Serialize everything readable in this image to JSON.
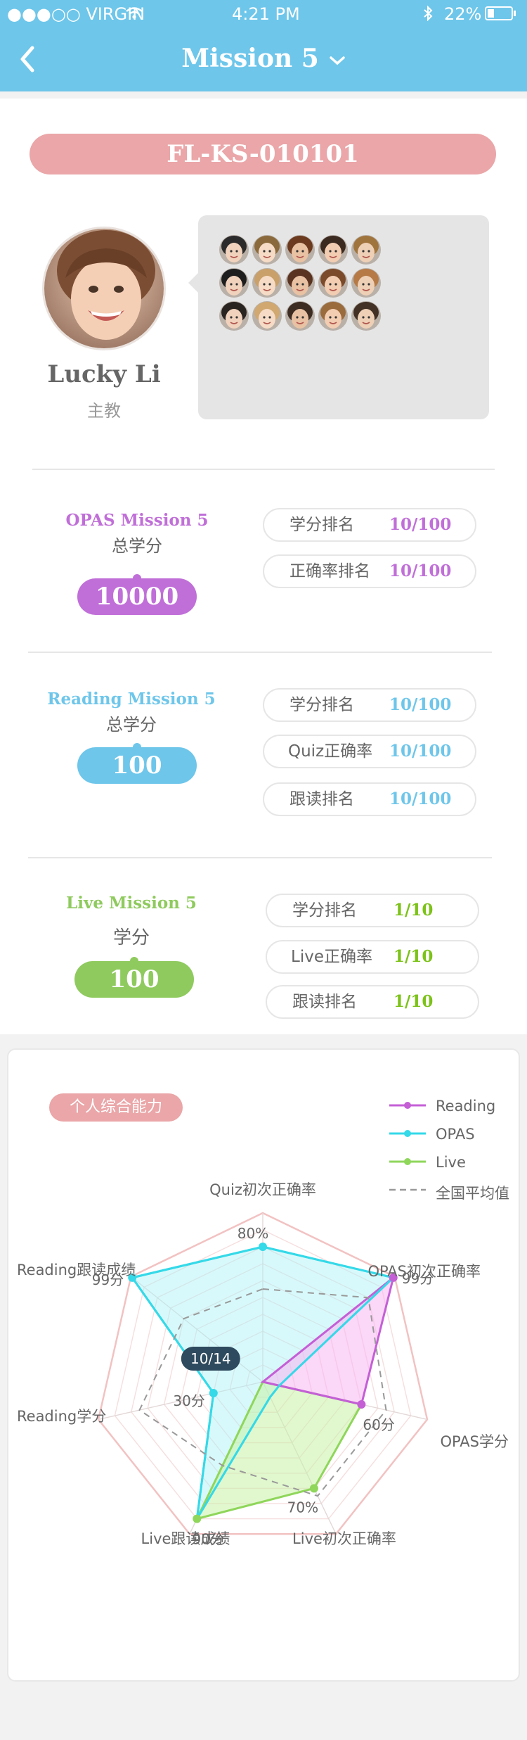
{
  "status_bar": {
    "carrier": "●●●○○ VIRGIN",
    "time": "4:21 PM",
    "battery": "22%"
  },
  "nav": {
    "title": "Mission 5"
  },
  "mission_code": "FL-KS-010101",
  "teacher": {
    "name": "Lucky Li",
    "role": "主教"
  },
  "student_count": 15,
  "opas": {
    "title": "OPAS Mission 5",
    "subtitle": "总学分",
    "score": "10000",
    "color": "#c06fd8",
    "ranks": [
      {
        "label": "学分排名",
        "value": "10/100"
      },
      {
        "label": "正确率排名",
        "value": "10/100"
      }
    ]
  },
  "reading": {
    "title": "Reading Mission 5",
    "subtitle": "总学分",
    "score": "100",
    "color": "#6ec6ea",
    "ranks": [
      {
        "label": "学分排名",
        "value": "10/100"
      },
      {
        "label": "Quiz正确率",
        "value": "10/100"
      },
      {
        "label": "跟读排名",
        "value": "10/100"
      }
    ]
  },
  "live": {
    "title": "Live Mission 5",
    "subtitle": "学分",
    "score": "100",
    "color": "#8fca5e",
    "value_color": "#7cc218",
    "ranks": [
      {
        "label": "学分排名",
        "value": "1/10"
      },
      {
        "label": "Live正确率",
        "value": "1/10"
      },
      {
        "label": "跟读排名",
        "value": "1/10"
      }
    ]
  },
  "chart_data": {
    "type": "radar",
    "tag": "个人综合能力",
    "axes": [
      "Quiz初次正确率",
      "OPAS初次正确率",
      "OPAS学分",
      "Live初次正确率",
      "Live跟读成绩",
      "Reading学分",
      "Reading跟读成绩"
    ],
    "rings": 10,
    "legend": [
      {
        "name": "Reading",
        "color": "#c45fd6",
        "style": "line-dot"
      },
      {
        "name": "OPAS",
        "color": "#35d9e8",
        "style": "line-dot"
      },
      {
        "name": "Live",
        "color": "#8fd65b",
        "style": "line-dot"
      },
      {
        "name": "全国平均值",
        "color": "#999999",
        "style": "dashed"
      }
    ],
    "series": [
      {
        "name": "OPAS",
        "color": "#35d9e8",
        "values": [
          0.8,
          0.99,
          0.1,
          0.1,
          0.9,
          0.3,
          0.99
        ]
      },
      {
        "name": "Reading",
        "color": "#c45fd6",
        "values": [
          0.0,
          0.99,
          0.6,
          0.0,
          0.0,
          0.0,
          0.0
        ]
      },
      {
        "name": "Live",
        "color": "#8fd65b",
        "values": [
          0.0,
          0.0,
          0.6,
          0.7,
          0.9,
          0.0,
          0.0
        ]
      },
      {
        "name": "全国平均值",
        "color": "#999999",
        "values": [
          0.55,
          0.8,
          0.75,
          0.75,
          0.55,
          0.75,
          0.6
        ]
      }
    ],
    "value_labels": [
      "80%",
      "99分",
      "60分",
      "70%",
      "90分",
      "30分",
      "99分"
    ],
    "badge": "10/14"
  }
}
